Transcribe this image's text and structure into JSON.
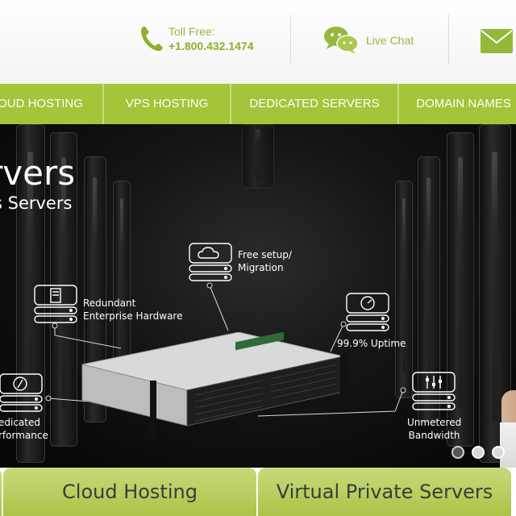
{
  "contact": {
    "toll_free_label": "Toll Free:",
    "toll_free_number": "+1.800.432.1474",
    "live_chat_label": "Live Chat",
    "accent_color": "#a4c43a"
  },
  "nav": {
    "items": [
      {
        "label": "OUD HOSTING"
      },
      {
        "label": "VPS HOSTING"
      },
      {
        "label": "DEDICATED SERVERS"
      },
      {
        "label": "DOMAIN NAMES"
      }
    ]
  },
  "hero": {
    "title": "rvers",
    "subtitle": "s Servers",
    "features": {
      "setup": "Free setup/\nMigration",
      "hardware": "Redundant\nEnterprise Hardware",
      "uptime": "99.9% Uptime",
      "performance": "edicated\nrformance",
      "bandwidth": "Unmetered\nBandwidth"
    },
    "slides": 3,
    "active_slide": 1
  },
  "tabs": [
    {
      "label": "Cloud Hosting"
    },
    {
      "label": "Virtual Private Servers"
    }
  ],
  "icons": [
    "phone-icon",
    "chat-bubbles-icon",
    "envelope-icon",
    "cloud-server-icon",
    "server-tower-icon",
    "speedometer-icon",
    "gauge-icon",
    "sliders-icon"
  ]
}
